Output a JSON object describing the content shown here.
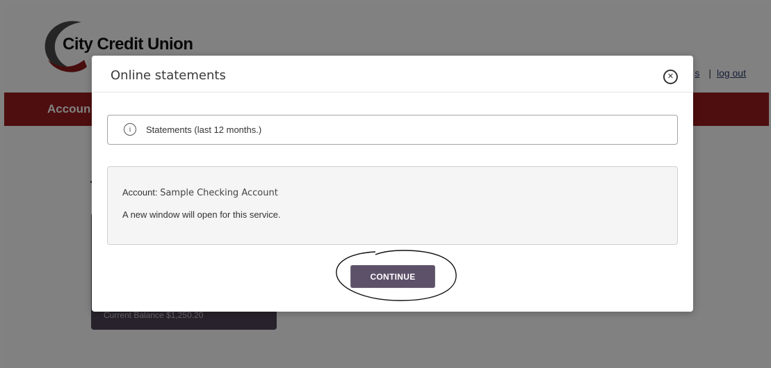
{
  "brand": {
    "name": "City Credit Union"
  },
  "header_links": {
    "partial_link": "s",
    "separator": "|",
    "logout": "log out"
  },
  "nav": {
    "label": "Accoun"
  },
  "account_card": {
    "balance_text": "Current Balance $1,250.20"
  },
  "modal": {
    "title": "Online statements",
    "close_symbol": "✕",
    "info_icon": "i",
    "info_text": "Statements (last 12 months.)",
    "account_label": "Account:",
    "account_value": "Sample Checking Account",
    "note": "A new window will open for this service.",
    "continue_label": "CONTINUE"
  },
  "colors": {
    "nav_red": "#9a1c1e",
    "button_purple": "#5d5069",
    "card_purple": "#4e4455"
  }
}
